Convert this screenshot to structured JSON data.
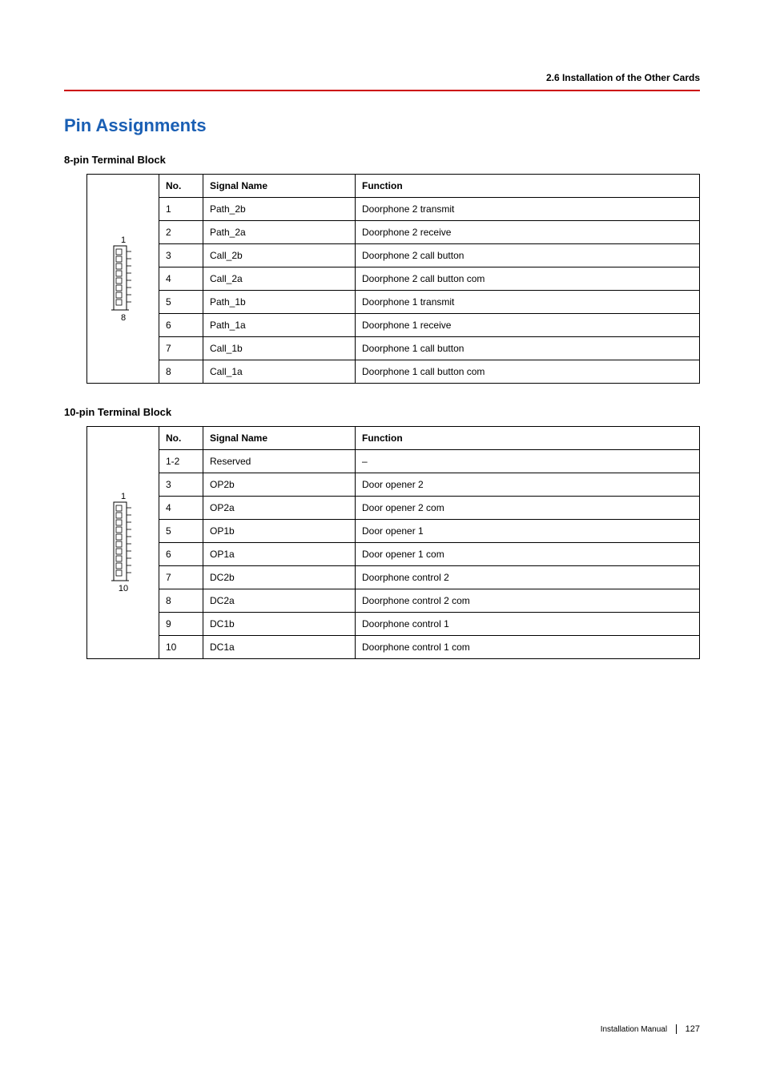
{
  "header": {
    "section_title": "2.6 Installation of the Other Cards"
  },
  "headings": {
    "main": "Pin Assignments",
    "sub1": "8-pin Terminal Block",
    "sub2": "10-pin Terminal Block"
  },
  "diagram8": {
    "top_label": "1",
    "bottom_label": "8"
  },
  "diagram10": {
    "top_label": "1",
    "bottom_label": "10"
  },
  "table8": {
    "headers": {
      "no": "No.",
      "signal": "Signal Name",
      "function": "Function"
    },
    "rows": [
      {
        "no": "1",
        "signal": "Path_2b",
        "function": "Doorphone 2 transmit"
      },
      {
        "no": "2",
        "signal": "Path_2a",
        "function": "Doorphone 2 receive"
      },
      {
        "no": "3",
        "signal": "Call_2b",
        "function": "Doorphone 2 call button"
      },
      {
        "no": "4",
        "signal": "Call_2a",
        "function": "Doorphone 2 call button com"
      },
      {
        "no": "5",
        "signal": "Path_1b",
        "function": "Doorphone 1 transmit"
      },
      {
        "no": "6",
        "signal": "Path_1a",
        "function": "Doorphone 1 receive"
      },
      {
        "no": "7",
        "signal": "Call_1b",
        "function": "Doorphone 1 call button"
      },
      {
        "no": "8",
        "signal": "Call_1a",
        "function": "Doorphone 1 call button com"
      }
    ]
  },
  "table10": {
    "headers": {
      "no": "No.",
      "signal": "Signal Name",
      "function": "Function"
    },
    "rows": [
      {
        "no": "1-2",
        "signal": "Reserved",
        "function": "–"
      },
      {
        "no": "3",
        "signal": "OP2b",
        "function": "Door opener 2"
      },
      {
        "no": "4",
        "signal": "OP2a",
        "function": "Door opener 2 com"
      },
      {
        "no": "5",
        "signal": "OP1b",
        "function": "Door opener 1"
      },
      {
        "no": "6",
        "signal": "OP1a",
        "function": "Door opener 1 com"
      },
      {
        "no": "7",
        "signal": "DC2b",
        "function": "Doorphone control 2"
      },
      {
        "no": "8",
        "signal": "DC2a",
        "function": "Doorphone control 2 com"
      },
      {
        "no": "9",
        "signal": "DC1b",
        "function": "Doorphone control 1"
      },
      {
        "no": "10",
        "signal": "DC1a",
        "function": "Doorphone control 1 com"
      }
    ]
  },
  "footer": {
    "manual": "Installation Manual",
    "page": "127"
  }
}
